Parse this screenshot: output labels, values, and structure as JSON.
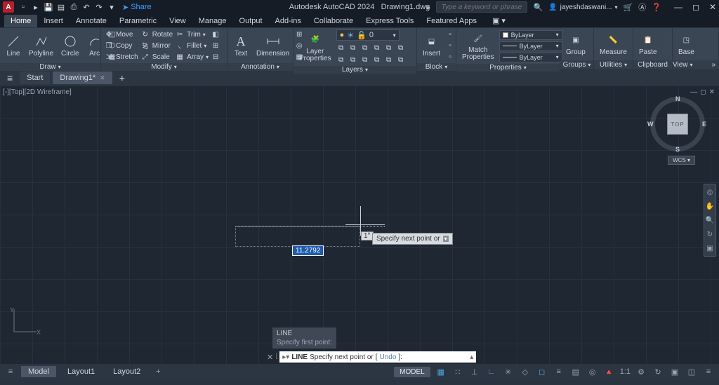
{
  "titlebar": {
    "share": "Share",
    "app": "Autodesk AutoCAD 2024",
    "doc": "Drawing1.dwg",
    "search_placeholder": "Type a keyword or phrase",
    "user": "jayeshdaswani..."
  },
  "ribbon_tabs": [
    "Home",
    "Insert",
    "Annotate",
    "Parametric",
    "View",
    "Manage",
    "Output",
    "Add-ins",
    "Collaborate",
    "Express Tools",
    "Featured Apps"
  ],
  "ribbon_active": "Home",
  "panels": {
    "draw": {
      "label": "Draw",
      "items": [
        "Line",
        "Polyline",
        "Circle",
        "Arc"
      ]
    },
    "modify": {
      "label": "Modify",
      "rows": [
        [
          "Move",
          "Rotate",
          "Trim"
        ],
        [
          "Copy",
          "Mirror",
          "Fillet"
        ],
        [
          "Stretch",
          "Scale",
          "Array"
        ]
      ]
    },
    "annotation": {
      "label": "Annotation",
      "items": [
        "Text",
        "Dimension"
      ]
    },
    "layers": {
      "label": "Layers",
      "big": "Layer\nProperties",
      "current": "0"
    },
    "block": {
      "label": "Block",
      "big": "Insert"
    },
    "properties": {
      "label": "Properties",
      "big": "Match\nProperties",
      "rows": [
        "ByLayer",
        "ByLayer",
        "ByLayer"
      ]
    },
    "groups": {
      "label": "Groups",
      "big": "Group"
    },
    "utilities": {
      "label": "Utilities",
      "big": "Measure"
    },
    "clipboard": {
      "label": "Clipboard",
      "big": "Paste"
    },
    "view": {
      "label": "View",
      "big": "Base"
    }
  },
  "doc_tabs": {
    "start": "Start",
    "drawing": "Drawing1*"
  },
  "viewport": {
    "label": "[-][Top][2D Wireframe]"
  },
  "navcube": {
    "face": "TOP",
    "n": "N",
    "s": "S",
    "e": "E",
    "w": "W",
    "wcs": "WCS"
  },
  "dynamic_input": {
    "dist": "11.2792",
    "angle": "1°",
    "prompt": "Specify next point or"
  },
  "cmd_history": {
    "cmd": "LINE",
    "l1": "Specify first point:"
  },
  "cmdline": {
    "kw": "LINE",
    "text": "Specify next point or",
    "opt": "Undo"
  },
  "layout_tabs": [
    "Model",
    "Layout1",
    "Layout2"
  ],
  "status": {
    "model": "MODEL",
    "scale": "1:1"
  }
}
